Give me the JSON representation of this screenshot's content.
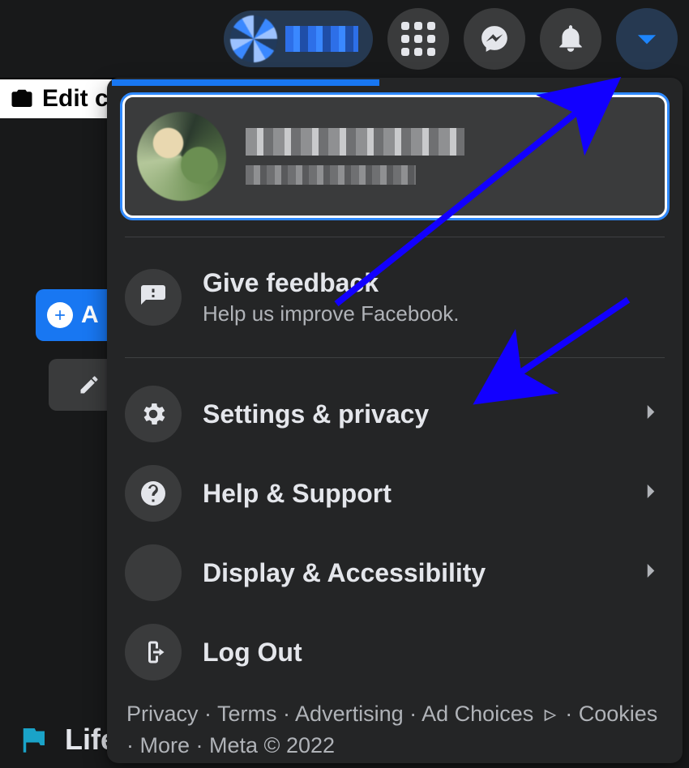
{
  "topbar": {
    "profile_name": "",
    "buttons": {
      "menu": "menu",
      "messenger": "messenger",
      "notifications": "notifications",
      "account": "account"
    }
  },
  "background": {
    "edit_label_fragment": "Edit c",
    "add_label_fragment": "A",
    "life_label_fragment": "Life"
  },
  "dropdown": {
    "profile": {
      "name": "",
      "subline": ""
    },
    "feedback": {
      "title": "Give feedback",
      "sub": "Help us improve Facebook."
    },
    "items": [
      {
        "icon": "gear",
        "label": "Settings & privacy",
        "chevron": true,
        "name": "settings-and-privacy"
      },
      {
        "icon": "question",
        "label": "Help & Support",
        "chevron": true,
        "name": "help-and-support"
      },
      {
        "icon": "moon",
        "label": "Display & Accessibility",
        "chevron": true,
        "name": "display-and-accessibility"
      },
      {
        "icon": "logout",
        "label": "Log Out",
        "chevron": false,
        "name": "log-out"
      }
    ],
    "footer": {
      "privacy": "Privacy",
      "terms": "Terms",
      "advertising": "Advertising",
      "ad_choices": "Ad Choices",
      "cookies": "Cookies",
      "more": "More",
      "meta": "Meta © 2022",
      "sep": " · "
    }
  }
}
